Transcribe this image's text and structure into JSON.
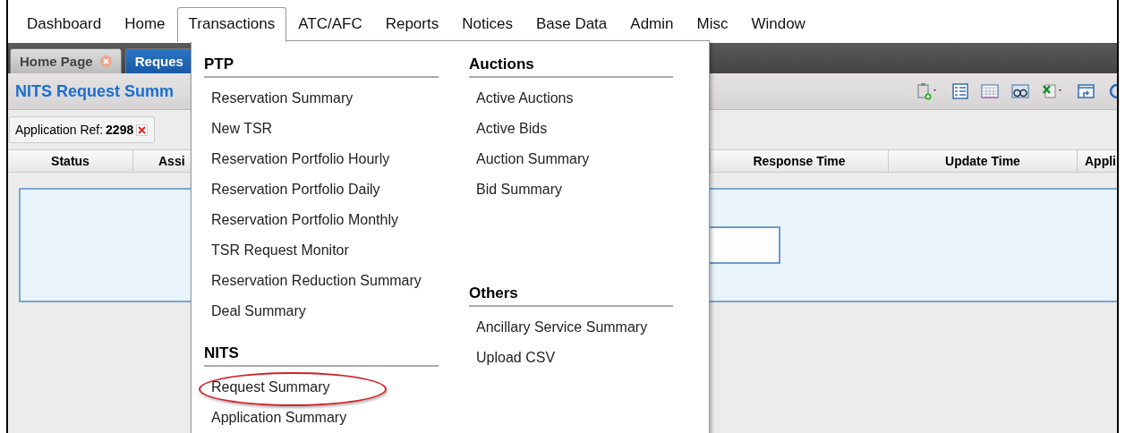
{
  "menu_bar": [
    {
      "label": "Dashboard",
      "selected": false
    },
    {
      "label": "Home",
      "selected": false
    },
    {
      "label": "Transactions",
      "selected": true
    },
    {
      "label": "ATC/AFC",
      "selected": false
    },
    {
      "label": "Reports",
      "selected": false
    },
    {
      "label": "Notices",
      "selected": false
    },
    {
      "label": "Base Data",
      "selected": false
    },
    {
      "label": "Admin",
      "selected": false
    },
    {
      "label": "Misc",
      "selected": false
    },
    {
      "label": "Window",
      "selected": false
    }
  ],
  "tabs": [
    {
      "label": "Home Page",
      "selected": false,
      "closable": true
    },
    {
      "label": "Reques",
      "selected": true,
      "closable": false
    }
  ],
  "panel": {
    "title": "NITS Request Summ"
  },
  "filter_chip": {
    "label": "Application Ref:",
    "value": "2298"
  },
  "table": {
    "columns": [
      "Status",
      "Assi",
      "Response Time",
      "Update Time",
      "Appli"
    ]
  },
  "dropdown": {
    "columns": [
      [
        {
          "heading": "PTP",
          "items": [
            {
              "label": "Reservation Summary",
              "highlighted": false
            },
            {
              "label": "New TSR",
              "highlighted": false
            },
            {
              "label": "Reservation Portfolio Hourly",
              "highlighted": false
            },
            {
              "label": "Reservation Portfolio Daily",
              "highlighted": false
            },
            {
              "label": "Reservation Portfolio Monthly",
              "highlighted": false
            },
            {
              "label": "TSR Request Monitor",
              "highlighted": false
            },
            {
              "label": "Reservation Reduction Summary",
              "highlighted": false
            },
            {
              "label": "Deal Summary",
              "highlighted": false
            }
          ]
        },
        {
          "heading": "NITS",
          "items": [
            {
              "label": "Request Summary",
              "highlighted": true
            },
            {
              "label": "Application Summary",
              "highlighted": false
            }
          ]
        }
      ],
      [
        {
          "heading": "Auctions",
          "items": [
            {
              "label": "Active Auctions",
              "highlighted": false
            },
            {
              "label": "Active Bids",
              "highlighted": false
            },
            {
              "label": "Auction Summary",
              "highlighted": false
            },
            {
              "label": "Bid Summary",
              "highlighted": false
            }
          ]
        },
        {
          "heading": "Others",
          "items": [
            {
              "label": "Ancillary Service Summary",
              "highlighted": false
            },
            {
              "label": "Upload CSV",
              "highlighted": false
            }
          ]
        }
      ]
    ]
  }
}
